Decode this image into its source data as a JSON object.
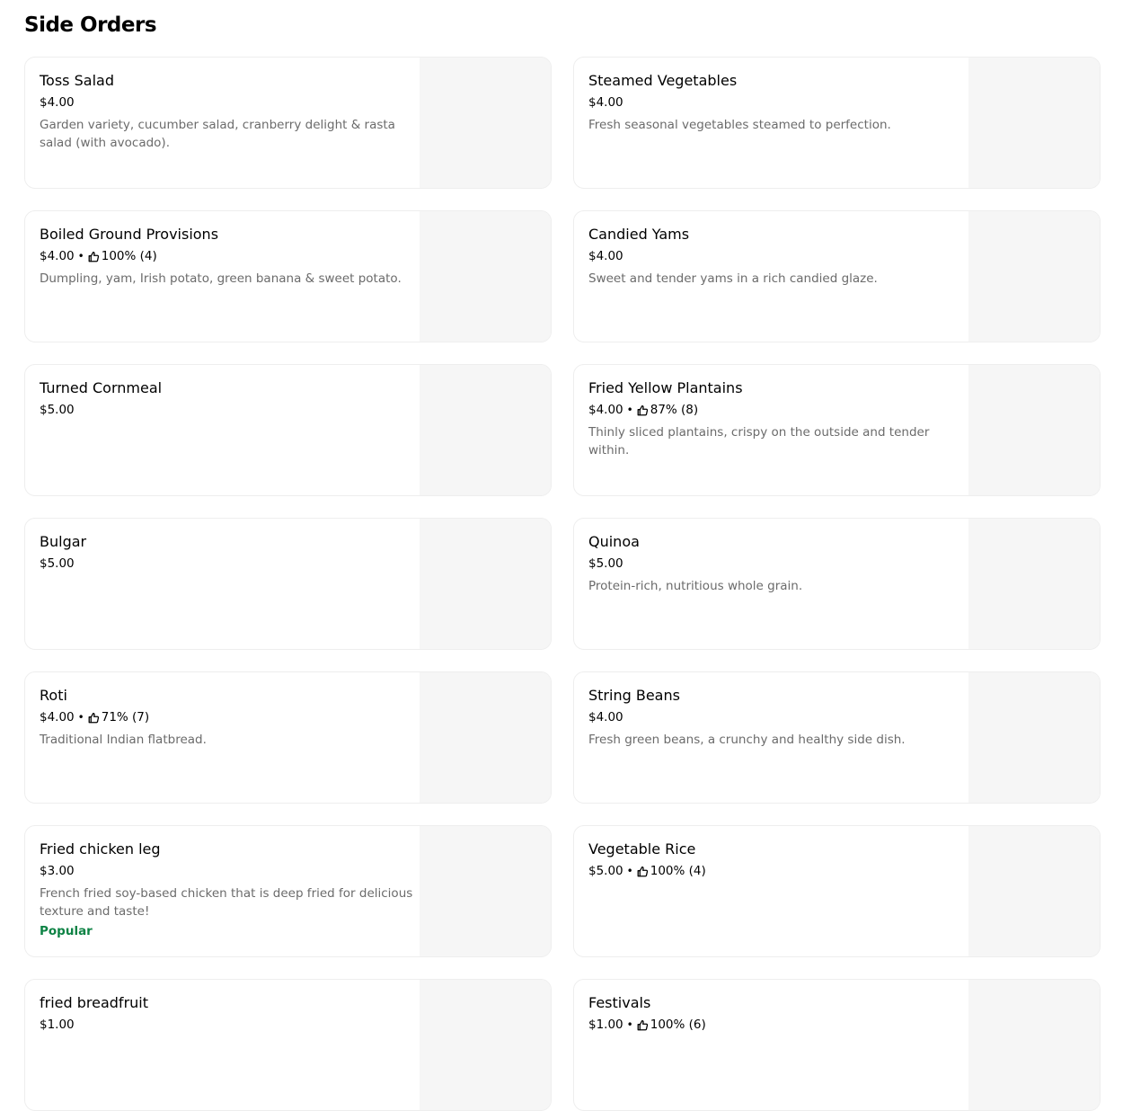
{
  "section": {
    "title": "Side Orders"
  },
  "items": [
    {
      "name": "Toss Salad",
      "price": "$4.00",
      "rating": "",
      "description": "Garden variety, cucumber salad, cranberry delight & rasta salad (with avocado).",
      "badge": ""
    },
    {
      "name": "Steamed Vegetables",
      "price": "$4.00",
      "rating": "",
      "description": "Fresh seasonal vegetables steamed to perfection.",
      "badge": ""
    },
    {
      "name": "Boiled Ground Provisions",
      "price": "$4.00",
      "rating": "100% (4)",
      "description": "Dumpling, yam, Irish potato, green banana & sweet potato.",
      "badge": ""
    },
    {
      "name": "Candied Yams",
      "price": "$4.00",
      "rating": "",
      "description": "Sweet and tender yams in a rich candied glaze.",
      "badge": ""
    },
    {
      "name": "Turned Cornmeal",
      "price": "$5.00",
      "rating": "",
      "description": "",
      "badge": ""
    },
    {
      "name": "Fried Yellow Plantains",
      "price": "$4.00",
      "rating": "87% (8)",
      "description": "Thinly sliced plantains, crispy on the outside and tender within.",
      "badge": ""
    },
    {
      "name": "Bulgar",
      "price": "$5.00",
      "rating": "",
      "description": "",
      "badge": ""
    },
    {
      "name": "Quinoa",
      "price": "$5.00",
      "rating": "",
      "description": "Protein-rich, nutritious whole grain.",
      "badge": ""
    },
    {
      "name": "Roti",
      "price": "$4.00",
      "rating": "71% (7)",
      "description": "Traditional Indian flatbread.",
      "badge": ""
    },
    {
      "name": "String Beans",
      "price": "$4.00",
      "rating": "",
      "description": "Fresh green beans, a crunchy and healthy side dish.",
      "badge": ""
    },
    {
      "name": "Fried chicken leg",
      "price": "$3.00",
      "rating": "",
      "description": "French fried soy-based chicken that is deep fried for delicious texture and taste!",
      "badge": "Popular"
    },
    {
      "name": "Vegetable Rice",
      "price": "$5.00",
      "rating": "100% (4)",
      "description": "",
      "badge": ""
    },
    {
      "name": "fried breadfruit",
      "price": "$1.00",
      "rating": "",
      "description": "",
      "badge": ""
    },
    {
      "name": "Festivals",
      "price": "$1.00",
      "rating": "100% (6)",
      "description": "",
      "badge": ""
    }
  ],
  "colors": {
    "badge": "#0e8345",
    "description": "#6b6b6b",
    "image_placeholder": "#f6f6f6",
    "card_border": "#eeeeee"
  },
  "icons": {
    "rating": "thumbs-up-icon"
  }
}
